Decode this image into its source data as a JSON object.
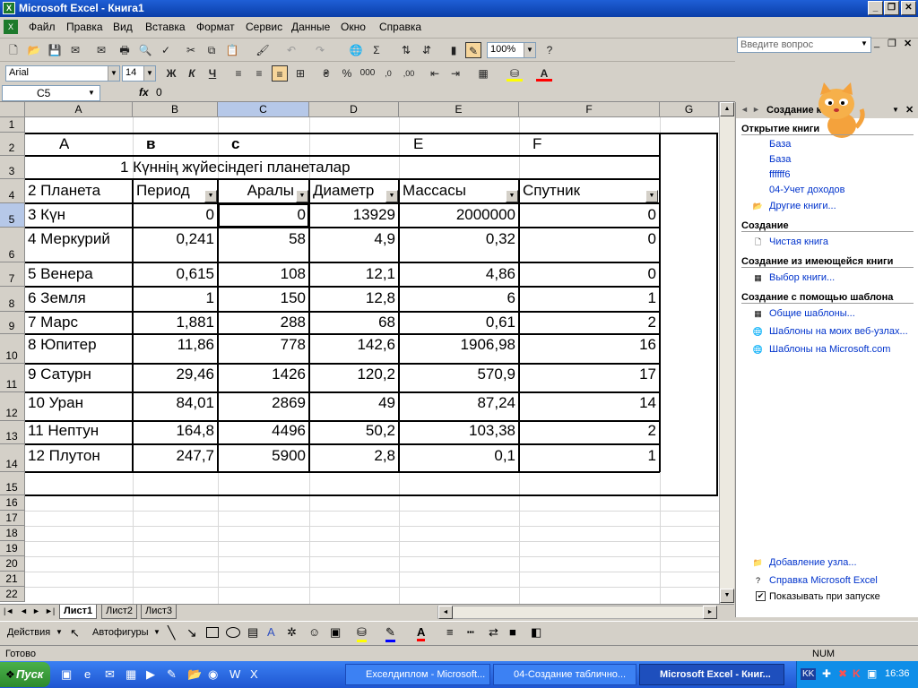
{
  "window": {
    "title": "Microsoft Excel - Книга1"
  },
  "menu": [
    "Файл",
    "Правка",
    "Вид",
    "Вставка",
    "Формат",
    "Сервис",
    "Данные",
    "Окно",
    "Справка"
  ],
  "ask_placeholder": "Введите вопрос",
  "toolbar": {
    "zoom": "100%",
    "font": "Arial",
    "font_size": "14"
  },
  "formula": {
    "cell_ref": "C5",
    "fx": "fx",
    "value": "0"
  },
  "columns": [
    "A",
    "B",
    "C",
    "D",
    "E",
    "F",
    "G"
  ],
  "rows": [
    "1",
    "2",
    "3",
    "4",
    "5",
    "6",
    "7",
    "8",
    "9",
    "10",
    "11",
    "12",
    "13",
    "14",
    "15",
    "16",
    "17",
    "18",
    "19",
    "20",
    "21",
    "22"
  ],
  "sheet": {
    "r2": [
      "A",
      "в",
      "c",
      "E",
      "F"
    ],
    "title": "1  Күннің жүйесіндегі планеталар",
    "headers": [
      "2 Планета",
      "Период",
      "Аралы",
      "Диаметр",
      "Массасы",
      "Спутник"
    ],
    "data": [
      [
        "3 Күн",
        "0",
        "0",
        "13929",
        "2000000",
        "0"
      ],
      [
        "4  Меркурий",
        "0,241",
        "58",
        "4,9",
        "0,32",
        "0"
      ],
      [
        "5 Венера",
        "0,615",
        "108",
        "12,1",
        "4,86",
        "0"
      ],
      [
        "6  Земля",
        "1",
        "150",
        "12,8",
        "6",
        "1"
      ],
      [
        "7   Марс",
        "1,881",
        "288",
        "68",
        "0,61",
        "2"
      ],
      [
        "8   Юпитер",
        "11,86",
        "778",
        "142,6",
        "1906,98",
        "16"
      ],
      [
        "9  Сатурн",
        "29,46",
        "1426",
        "120,2",
        "570,9",
        "17"
      ],
      [
        "10 Уран",
        "84,01",
        "2869",
        "49",
        "87,24",
        "14"
      ],
      [
        "11 Нептун",
        "164,8",
        "4496",
        "50,2",
        "103,38",
        "2"
      ],
      [
        "12 Плутон",
        "247,7",
        "5900",
        "2,8",
        "0,1",
        "1"
      ]
    ]
  },
  "tabs": [
    "Лист1",
    "Лист2",
    "Лист3"
  ],
  "drawbar": {
    "actions": "Действия",
    "autoshapes": "Автофигуры"
  },
  "status": {
    "left": "Готово",
    "num": "NUM"
  },
  "taskpane": {
    "title": "Создание книги",
    "open_title": "Открытие книги",
    "open_links": [
      "База",
      "База",
      "ffffff6",
      "04-Учет доходов",
      "Другие книги..."
    ],
    "create_title": "Создание",
    "blank": "Чистая книга",
    "from_existing_title": "Создание из имеющейся книги",
    "choose": "Выбор книги...",
    "template_title": "Создание с помощью шаблона",
    "templates": [
      "Общие шаблоны...",
      "Шаблоны на моих веб-узлах...",
      "Шаблоны на Microsoft.com"
    ],
    "add_node": "Добавление узла...",
    "help": "Справка Microsoft Excel",
    "show_at_start": "Показывать при запуске"
  },
  "taskbar": {
    "start": "Пуск",
    "tasks": [
      "Exceлдиплом - Microsoft...",
      "04-Создание таблично...",
      "Microsoft Excel - Книг..."
    ],
    "lang": "KK",
    "clock": "16:36"
  }
}
